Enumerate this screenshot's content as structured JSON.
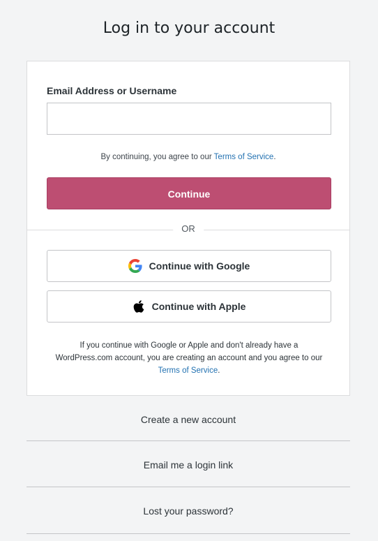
{
  "page": {
    "title": "Log in to your account"
  },
  "form": {
    "email_label": "Email Address or Username",
    "email_value": "",
    "tos_prefix": "By continuing, you agree to our ",
    "tos_link": "Terms of Service",
    "tos_suffix": ".",
    "continue_label": "Continue",
    "or_label": "OR"
  },
  "social": {
    "google_label": "Continue with Google",
    "apple_label": "Continue with Apple",
    "notice_prefix": "If you continue with Google or Apple and don't already have a WordPress.com account, you are creating an account and you agree to our ",
    "notice_link": "Terms of Service",
    "notice_suffix": "."
  },
  "links": {
    "create_account": "Create a new account",
    "email_login_link": "Email me a login link",
    "lost_password": "Lost your password?"
  },
  "colors": {
    "primary_button": "#bd4e72",
    "link": "#2271b1",
    "background": "#f3f4f5"
  },
  "icons": {
    "google": "google-icon",
    "apple": "apple-icon"
  }
}
